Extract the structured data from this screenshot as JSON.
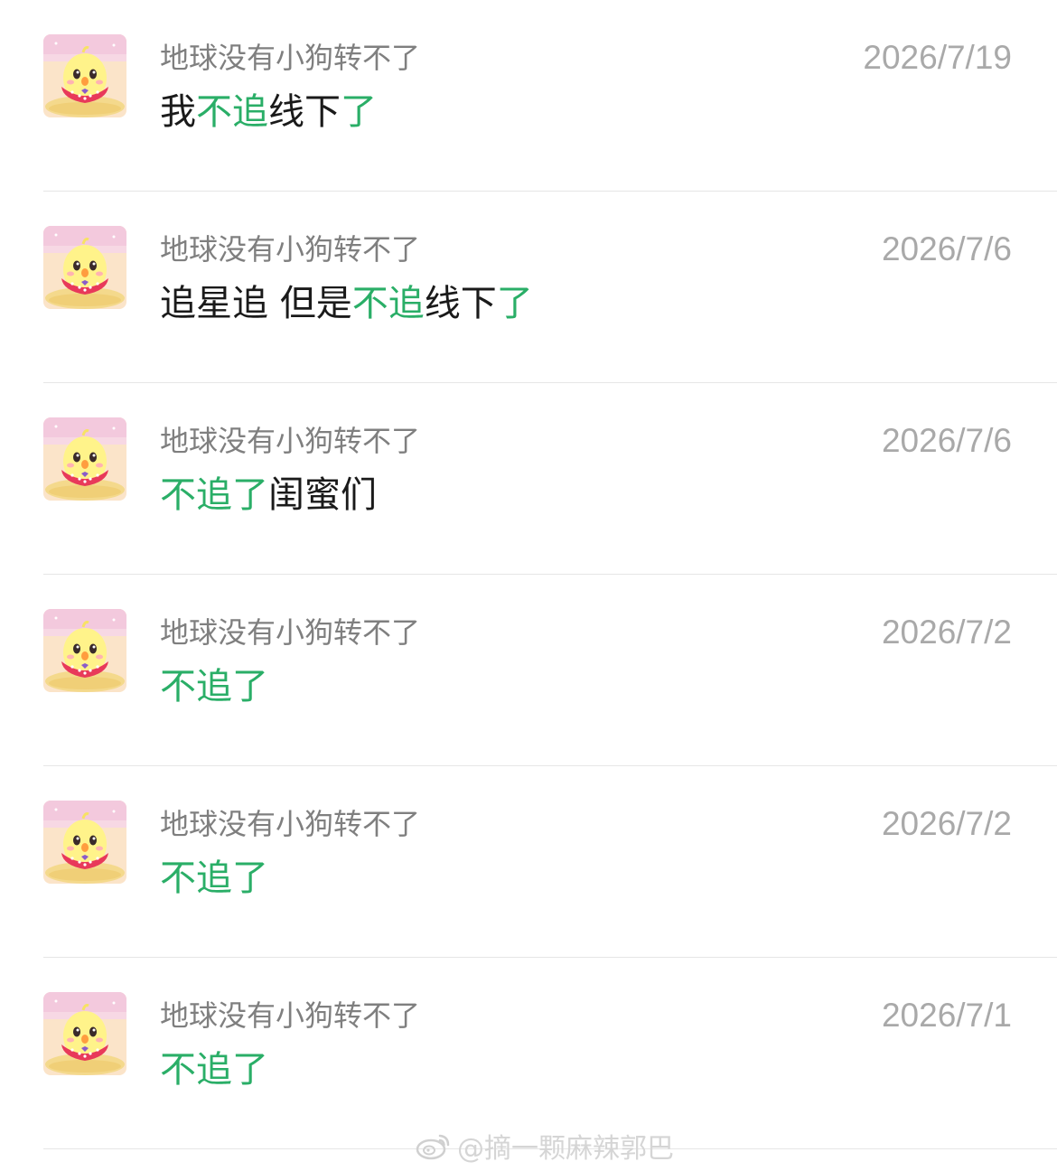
{
  "accent_color": "#2aae67",
  "comments": [
    {
      "username": "地球没有小狗转不了",
      "timestamp": "2026/7/19",
      "message": [
        {
          "text": "我",
          "highlight": false
        },
        {
          "text": "不追",
          "highlight": true
        },
        {
          "text": "线下",
          "highlight": false
        },
        {
          "text": "了",
          "highlight": true
        }
      ]
    },
    {
      "username": "地球没有小狗转不了",
      "timestamp": "2026/7/6",
      "message": [
        {
          "text": "追星追 但是",
          "highlight": false
        },
        {
          "text": "不追",
          "highlight": true
        },
        {
          "text": "线下",
          "highlight": false
        },
        {
          "text": "了",
          "highlight": true
        }
      ]
    },
    {
      "username": "地球没有小狗转不了",
      "timestamp": "2026/7/6",
      "message": [
        {
          "text": "不追了",
          "highlight": true
        },
        {
          "text": "闺蜜们",
          "highlight": false
        }
      ]
    },
    {
      "username": "地球没有小狗转不了",
      "timestamp": "2026/7/2",
      "message": [
        {
          "text": "不追了",
          "highlight": true
        }
      ]
    },
    {
      "username": "地球没有小狗转不了",
      "timestamp": "2026/7/2",
      "message": [
        {
          "text": "不追了",
          "highlight": true
        }
      ]
    },
    {
      "username": "地球没有小狗转不了",
      "timestamp": "2026/7/1",
      "message": [
        {
          "text": "不追了",
          "highlight": true
        }
      ]
    }
  ],
  "watermark": {
    "icon": "weibo-icon",
    "text": "@摘一颗麻辣郭巴"
  }
}
